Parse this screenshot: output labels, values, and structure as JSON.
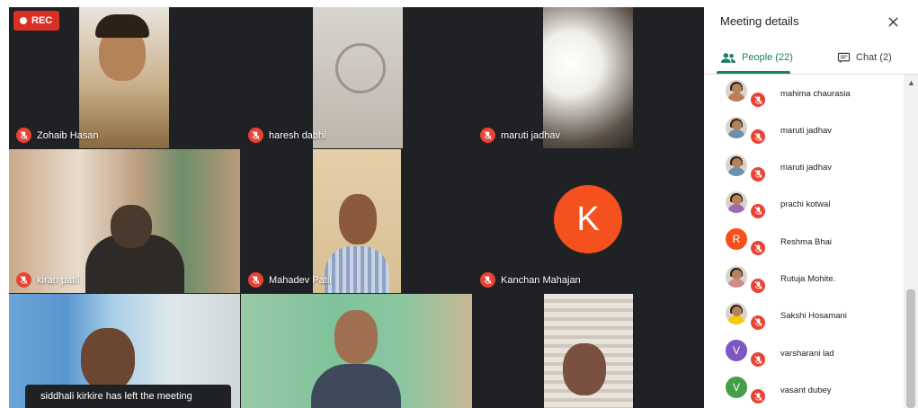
{
  "recording": {
    "label": "REC"
  },
  "tiles": [
    {
      "name": "Zohaib Hasan"
    },
    {
      "name": "haresh dabhi"
    },
    {
      "name": "maruti jadhav"
    },
    {
      "name": "kiran patil"
    },
    {
      "name": "Mahadev Patil"
    },
    {
      "name": "Kanchan Mahajan",
      "initial": "K"
    },
    {
      "name": ""
    },
    {
      "name": ""
    },
    {
      "name": ""
    }
  ],
  "toast": "siddhali kirkire has left the meeting",
  "panel": {
    "title": "Meeting details",
    "tabs": {
      "people": "People (22)",
      "chat": "Chat (2)"
    },
    "participants": [
      {
        "name": "mahima chaurasia",
        "avatar": "photo",
        "color": "#c07a5a"
      },
      {
        "name": "maruti jadhav",
        "avatar": "photo",
        "color": "#6b8fb0"
      },
      {
        "name": "maruti jadhav",
        "avatar": "photo",
        "color": "#6b8fb0"
      },
      {
        "name": "prachi kotwal",
        "avatar": "photo",
        "color": "#9b6bb0"
      },
      {
        "name": "Reshma Bhai",
        "avatar": "letter",
        "initial": "R",
        "color": "#f4511e"
      },
      {
        "name": "Rutuja Mohite.",
        "avatar": "photo",
        "color": "#d08b8b"
      },
      {
        "name": "Sakshi Hosamani",
        "avatar": "photo",
        "color": "#f6c900"
      },
      {
        "name": "varsharani lad",
        "avatar": "letter",
        "initial": "V",
        "color": "#7e57c2"
      },
      {
        "name": "vasant dubey",
        "avatar": "letter",
        "initial": "V",
        "color": "#43a047"
      }
    ]
  },
  "colors": {
    "mute": "#ea4335",
    "accent": "#1a7f64",
    "stage": "#202124"
  }
}
